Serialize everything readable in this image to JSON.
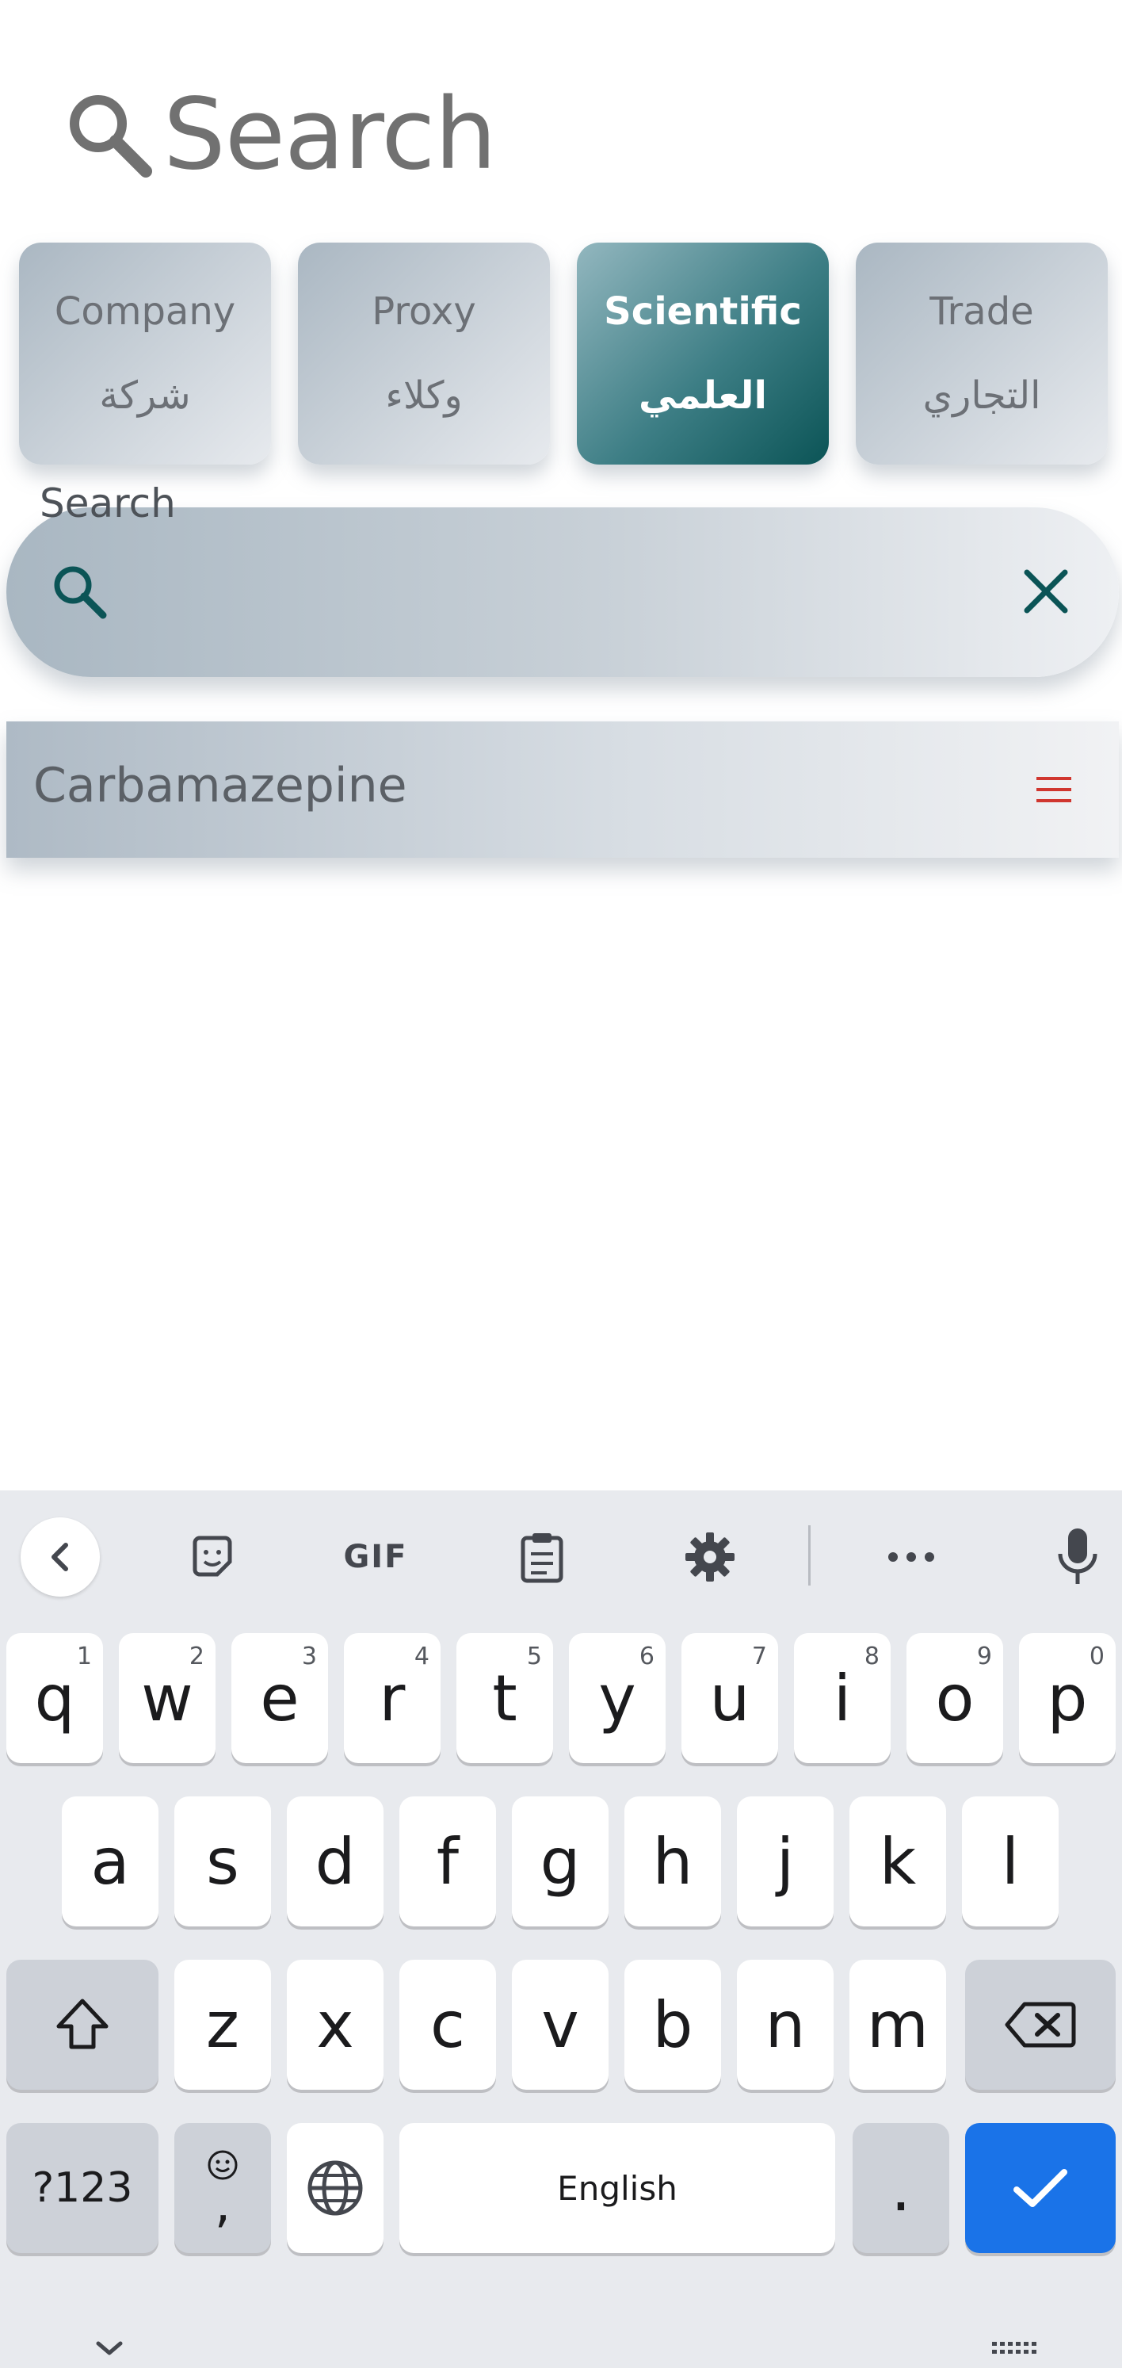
{
  "header": {
    "title": "Search",
    "icon": "search-icon"
  },
  "tabs": [
    {
      "en": "Company",
      "ar": "شركة",
      "active": false
    },
    {
      "en": "Proxy",
      "ar": "وكلاء",
      "active": false
    },
    {
      "en": "Scientific",
      "ar": "العلمي",
      "active": true
    },
    {
      "en": "Trade",
      "ar": "التجاري",
      "active": false
    }
  ],
  "search": {
    "label": "Search",
    "value": ""
  },
  "results": [
    {
      "name": "Carbamazepine"
    }
  ],
  "keyboard": {
    "toolbar": [
      "back-icon",
      "sticker-icon",
      "GIF",
      "clipboard-icon",
      "gear-icon",
      "more-icon",
      "mic-icon"
    ],
    "gif_label": "GIF",
    "row1": [
      {
        "k": "q",
        "h": "1"
      },
      {
        "k": "w",
        "h": "2"
      },
      {
        "k": "e",
        "h": "3"
      },
      {
        "k": "r",
        "h": "4"
      },
      {
        "k": "t",
        "h": "5"
      },
      {
        "k": "y",
        "h": "6"
      },
      {
        "k": "u",
        "h": "7"
      },
      {
        "k": "i",
        "h": "8"
      },
      {
        "k": "o",
        "h": "9"
      },
      {
        "k": "p",
        "h": "0"
      }
    ],
    "row2": [
      "a",
      "s",
      "d",
      "f",
      "g",
      "h",
      "j",
      "k",
      "l"
    ],
    "row3": [
      "z",
      "x",
      "c",
      "v",
      "b",
      "n",
      "m"
    ],
    "symbols_label": "?123",
    "comma_label": ",",
    "space_label": "English",
    "period_label": ".",
    "colors": {
      "enter": "#1a73e8",
      "accent": "#0b5456"
    }
  }
}
